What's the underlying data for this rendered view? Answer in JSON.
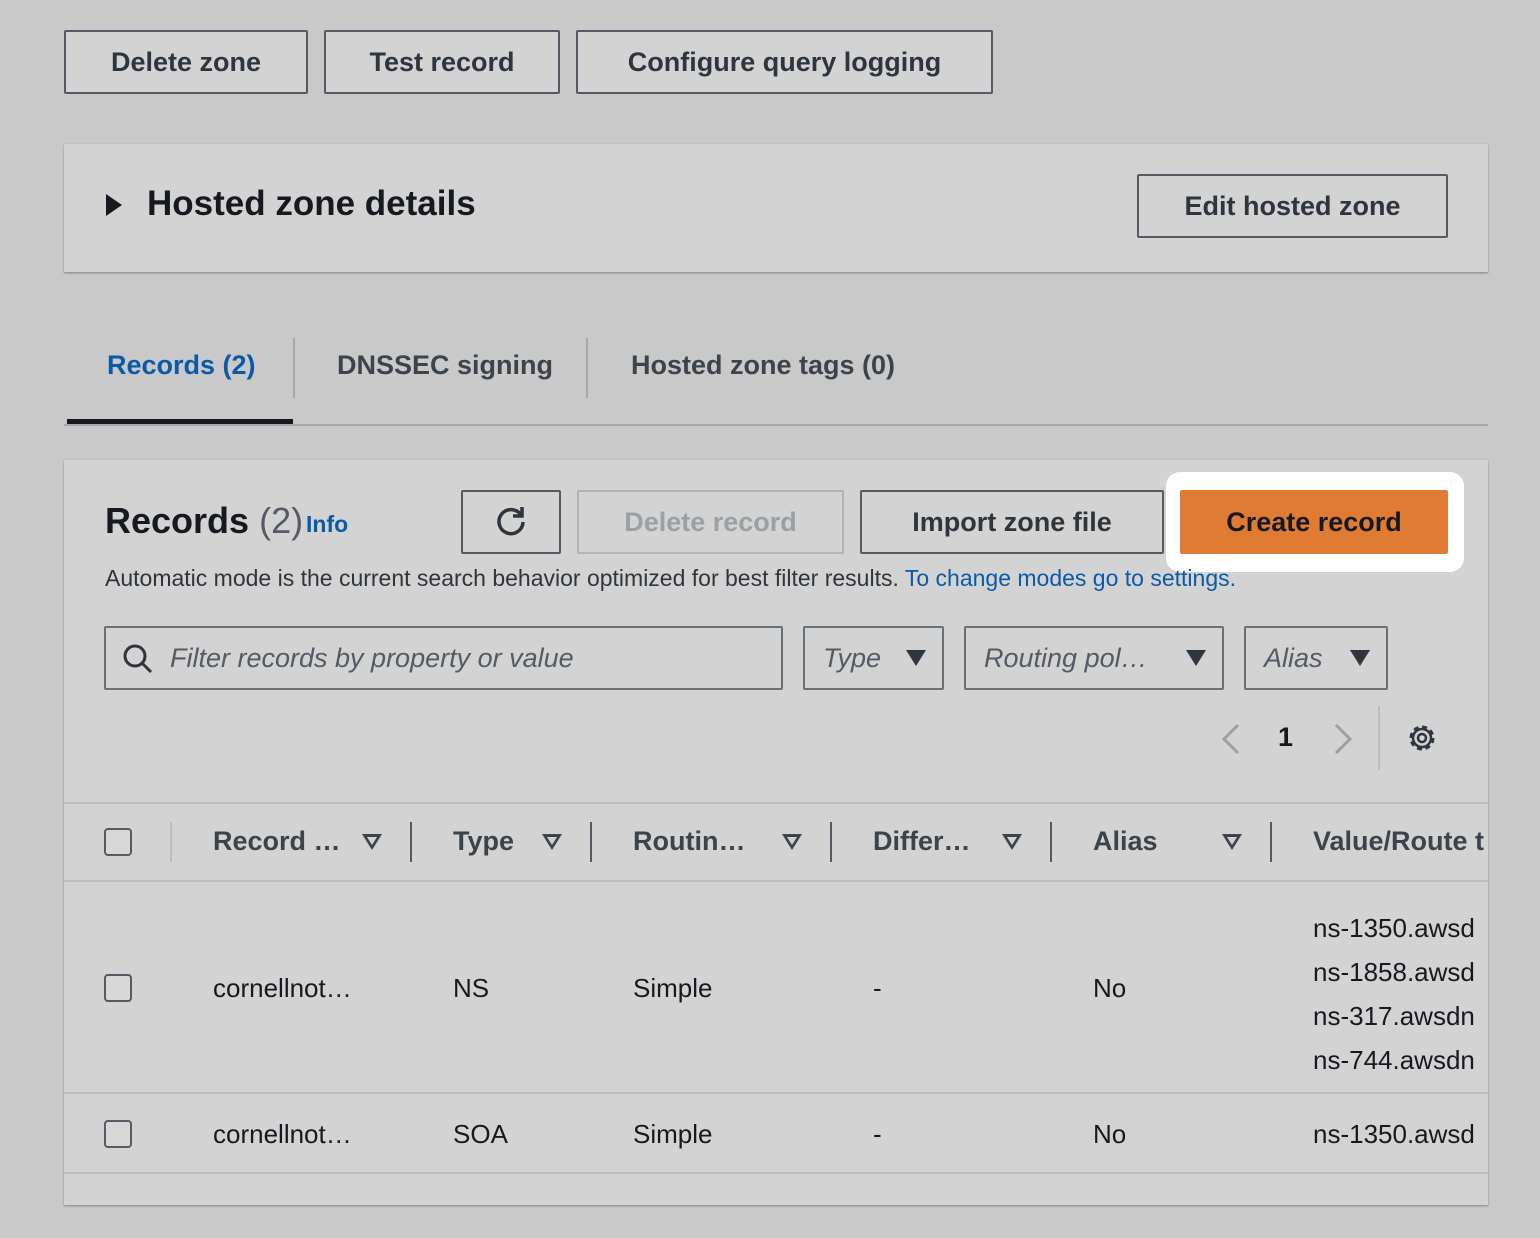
{
  "top_actions": {
    "delete_zone": "Delete zone",
    "test_record": "Test record",
    "configure_logging": "Configure query logging"
  },
  "details": {
    "title": "Hosted zone details",
    "edit_button": "Edit hosted zone"
  },
  "tabs": [
    {
      "label": "Records (2)",
      "active": true
    },
    {
      "label": "DNSSEC signing"
    },
    {
      "label": "Hosted zone tags (0)"
    }
  ],
  "records": {
    "title": "Records",
    "count": "(2)",
    "info": "Info",
    "delete_record": "Delete record",
    "import_zone_file": "Import zone file",
    "create_record": "Create record",
    "description": "Automatic mode is the current search behavior optimized for best filter results.",
    "settings_link": "To change modes go to settings.",
    "search_placeholder": "Filter records by property or value",
    "filters": {
      "type": "Type",
      "routing": "Routing pol…",
      "alias": "Alias"
    },
    "page": "1",
    "columns": [
      "Record …",
      "Type",
      "Routin…",
      "Differ…",
      "Alias",
      "Value/Route t"
    ],
    "rows": [
      {
        "name": "cornellnot…",
        "type": "NS",
        "routing": "Simple",
        "differ": "-",
        "alias": "No",
        "values": [
          "ns-1350.awsd",
          "ns-1858.awsd",
          "ns-317.awsdn",
          "ns-744.awsdn"
        ]
      },
      {
        "name": "cornellnot…",
        "type": "SOA",
        "routing": "Simple",
        "differ": "-",
        "alias": "No",
        "values": [
          "ns-1350.awsd"
        ]
      }
    ]
  },
  "colors": {
    "accent": "#e07b33",
    "link": "#0b5aa8"
  }
}
